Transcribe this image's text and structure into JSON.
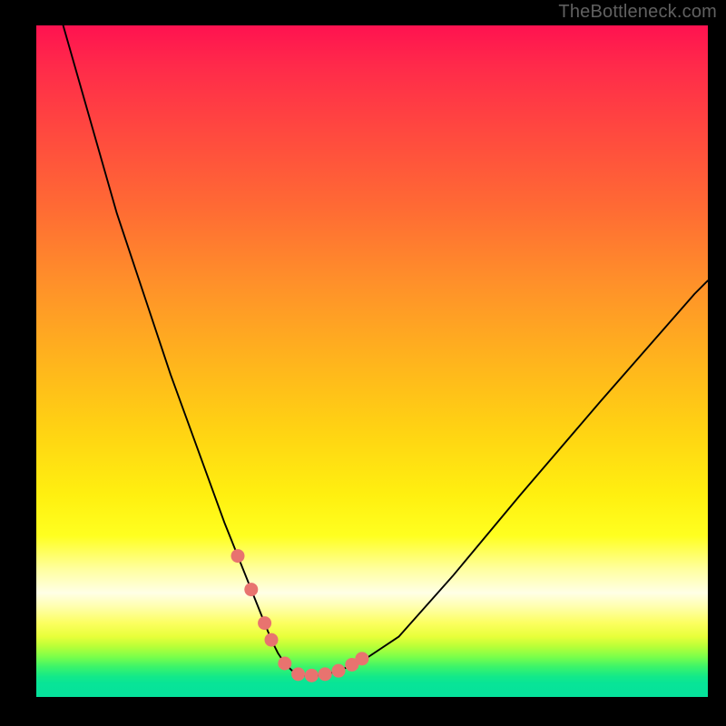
{
  "watermark": "TheBottleneck.com",
  "colors": {
    "page_bg": "#000000",
    "curve_stroke": "#000000",
    "marker_fill": "#e8736f",
    "gradient_top": "#ff1250",
    "gradient_mid": "#ffff20",
    "gradient_bottom": "#05e29c"
  },
  "chart_data": {
    "type": "line",
    "title": "",
    "xlabel": "",
    "ylabel": "",
    "xlim": [
      0,
      100
    ],
    "ylim": [
      0,
      100
    ],
    "grid": false,
    "legend": false,
    "series": [
      {
        "name": "bottleneck-curve",
        "x": [
          4,
          8,
          12,
          16,
          20,
          24,
          28,
          30,
          32,
          34,
          35,
          36,
          37,
          38,
          39,
          40,
          42,
          44,
          48,
          54,
          62,
          72,
          84,
          98,
          100
        ],
        "y": [
          100,
          86,
          72,
          60,
          48,
          37,
          26,
          21,
          16,
          11,
          8.5,
          6.5,
          5,
          4,
          3.4,
          3.2,
          3.2,
          3.6,
          5,
          9,
          18,
          30,
          44,
          60,
          62
        ]
      }
    ],
    "markers": {
      "name": "highlighted-points",
      "x": [
        30,
        32,
        34,
        35,
        37,
        39,
        41,
        43,
        45,
        47,
        48.5
      ],
      "y": [
        21,
        16,
        11,
        8.5,
        5,
        3.4,
        3.2,
        3.4,
        3.9,
        4.8,
        5.7
      ]
    },
    "annotations": []
  }
}
